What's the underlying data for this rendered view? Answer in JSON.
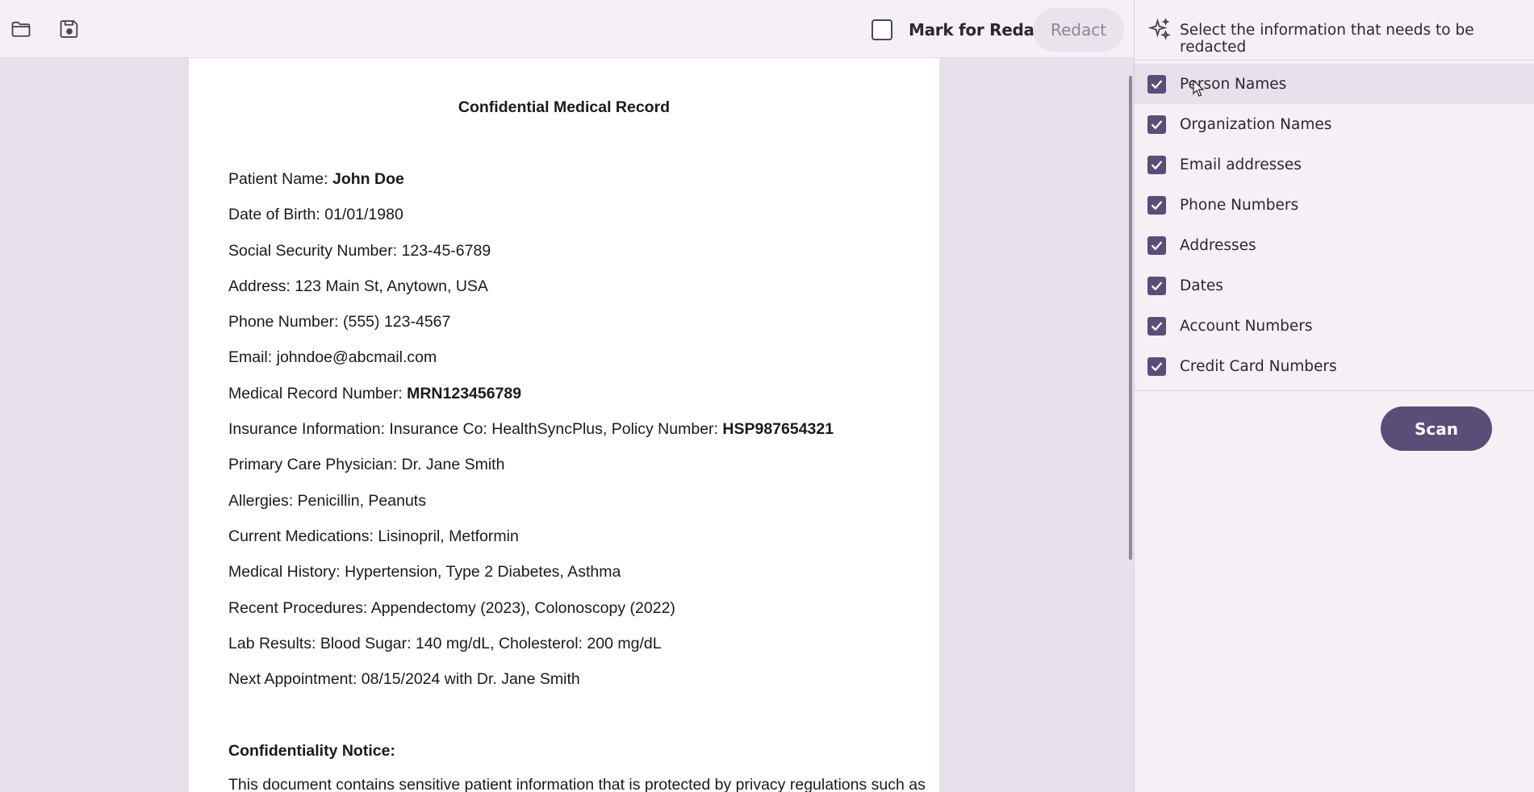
{
  "toolbar": {
    "open_icon": "folder-icon",
    "save_icon": "save-icon",
    "mark_for_redact_label": "Mark for Redact",
    "mark_for_redact_checked": false,
    "redact_label": "Redact"
  },
  "document": {
    "title": "Confidential Medical Record",
    "lines": [
      {
        "label": "Patient Name: ",
        "value": "John Doe",
        "bold": true
      },
      {
        "label": "Date of Birth: ",
        "value": "01/01/1980",
        "bold": false
      },
      {
        "label": "Social Security Number: ",
        "value": "123-45-6789",
        "bold": false
      },
      {
        "label": "Address: ",
        "value": "123 Main St, Anytown, USA",
        "bold": false
      },
      {
        "label": "Phone Number: ",
        "value": "(555) 123-4567",
        "bold": false
      },
      {
        "label": "Email: ",
        "value": "johndoe@abcmail.com",
        "bold": false
      },
      {
        "label": "Medical Record Number: ",
        "value": "MRN123456789",
        "bold": true
      },
      {
        "label": "Insurance Information: Insurance Co: HealthSyncPlus, Policy Number: ",
        "value": "HSP987654321",
        "bold": true
      },
      {
        "label": "Primary Care Physician: ",
        "value": "Dr. Jane Smith",
        "bold": false
      },
      {
        "label": "Allergies: ",
        "value": "Penicillin, Peanuts",
        "bold": false
      },
      {
        "label": "Current Medications: ",
        "value": "Lisinopril, Metformin",
        "bold": false
      },
      {
        "label": "Medical History: ",
        "value": "Hypertension, Type 2 Diabetes, Asthma",
        "bold": false
      },
      {
        "label": "Recent Procedures: ",
        "value": "Appendectomy (2023), Colonoscopy (2022)",
        "bold": false
      },
      {
        "label": "Lab Results: ",
        "value": "Blood Sugar: 140 mg/dL, Cholesterol: 200 mg/dL",
        "bold": false
      },
      {
        "label": "Next Appointment: ",
        "value": "08/15/2024 with Dr. Jane Smith",
        "bold": false
      }
    ],
    "notice_title": "Confidentiality Notice:",
    "notice_body": "This document contains sensitive patient information that is protected by privacy regulations such as"
  },
  "panel": {
    "icon": "sparkle-icon",
    "title": "Select the information that needs to be redacted",
    "options": [
      {
        "label": "Person Names",
        "checked": true
      },
      {
        "label": "Organization Names",
        "checked": true
      },
      {
        "label": "Email addresses",
        "checked": true
      },
      {
        "label": "Phone Numbers",
        "checked": true
      },
      {
        "label": "Addresses",
        "checked": true
      },
      {
        "label": "Dates",
        "checked": true
      },
      {
        "label": "Account Numbers",
        "checked": true
      },
      {
        "label": "Credit Card Numbers",
        "checked": true
      }
    ],
    "scan_label": "Scan"
  },
  "colors": {
    "accent": "#5a4e78",
    "panel_bg": "#f4f0f6",
    "canvas_bg": "#e7e0eb"
  }
}
